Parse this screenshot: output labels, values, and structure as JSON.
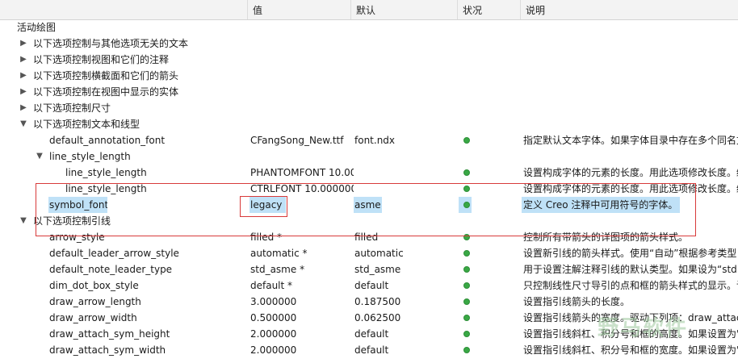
{
  "header": {
    "col1": "",
    "col2": "值",
    "col3": "默认",
    "col4": "状况",
    "col5": "说明"
  },
  "root_label": "活动绘图",
  "groups": [
    "以下选项控制与其他选项无关的文本",
    "以下选项控制视图和它们的注释",
    "以下选项控制横截面和它们的箭头",
    "以下选项控制在视图中显示的实体",
    "以下选项控制尺寸",
    "以下选项控制文本和线型"
  ],
  "rows_a": [
    {
      "name": "default_annotation_font",
      "value": "CFangSong_New.ttf",
      "default": "font.ndx",
      "desc": "指定默认文本字体。如果字体目录中存在多个同名文"
    },
    {
      "name": "line_style_length",
      "value": "",
      "default": "",
      "desc": ""
    },
    {
      "name": "line_style_length",
      "value": "PHANTOMFONT 10.000000",
      "default": "",
      "desc": "设置构成字体的元素的长度。用此选项修改长度。绘"
    },
    {
      "name": "line_style_length",
      "value": "CTRLFONT 10.000000",
      "default": "",
      "desc": "设置构成字体的元素的长度。用此选项修改长度。绘"
    },
    {
      "name": "symbol_font",
      "value": "legacy",
      "default": "asme",
      "desc": "定义 Creo 注释中可用符号的字体。"
    }
  ],
  "group_leader": "以下选项控制引线",
  "rows_b": [
    {
      "name": "arrow_style",
      "value": "filled *",
      "default": "filled",
      "desc": "控制所有带箭头的详图项的箭头样式。"
    },
    {
      "name": "default_leader_arrow_style",
      "value": "automatic *",
      "default": "automatic",
      "desc": "设置新引线的箭头样式。使用“自动”根据参考类型"
    },
    {
      "name": "default_note_leader_type",
      "value": "std_asme *",
      "default": "std_asme",
      "desc": "用于设置注解注释引线的默认类型。如果设为“std"
    },
    {
      "name": "dim_dot_box_style",
      "value": "default *",
      "default": "default",
      "desc": "只控制线性尺寸导引的点和框的箭头样式的显示。该"
    },
    {
      "name": "draw_arrow_length",
      "value": "3.000000",
      "default": "0.187500",
      "desc": "设置指引线箭头的长度。"
    },
    {
      "name": "draw_arrow_width",
      "value": "0.500000",
      "default": "0.062500",
      "desc": "设置指引线箭头的宽度。驱动下列项：draw_attac"
    },
    {
      "name": "draw_attach_sym_height",
      "value": "2.000000",
      "default": "default",
      "desc": "设置指引线斜杠、积分号和框的高度。如果设置为\""
    },
    {
      "name": "draw_attach_sym_width",
      "value": "2.000000",
      "default": "default",
      "desc": "设置指引线斜杠、积分号和框的宽度。如果设置为\""
    }
  ],
  "watermark": "野马软件",
  "colors": {
    "status_dot": "#39a845",
    "highlight": "#bfe1f7",
    "annotation_box": "#d83a3a"
  }
}
